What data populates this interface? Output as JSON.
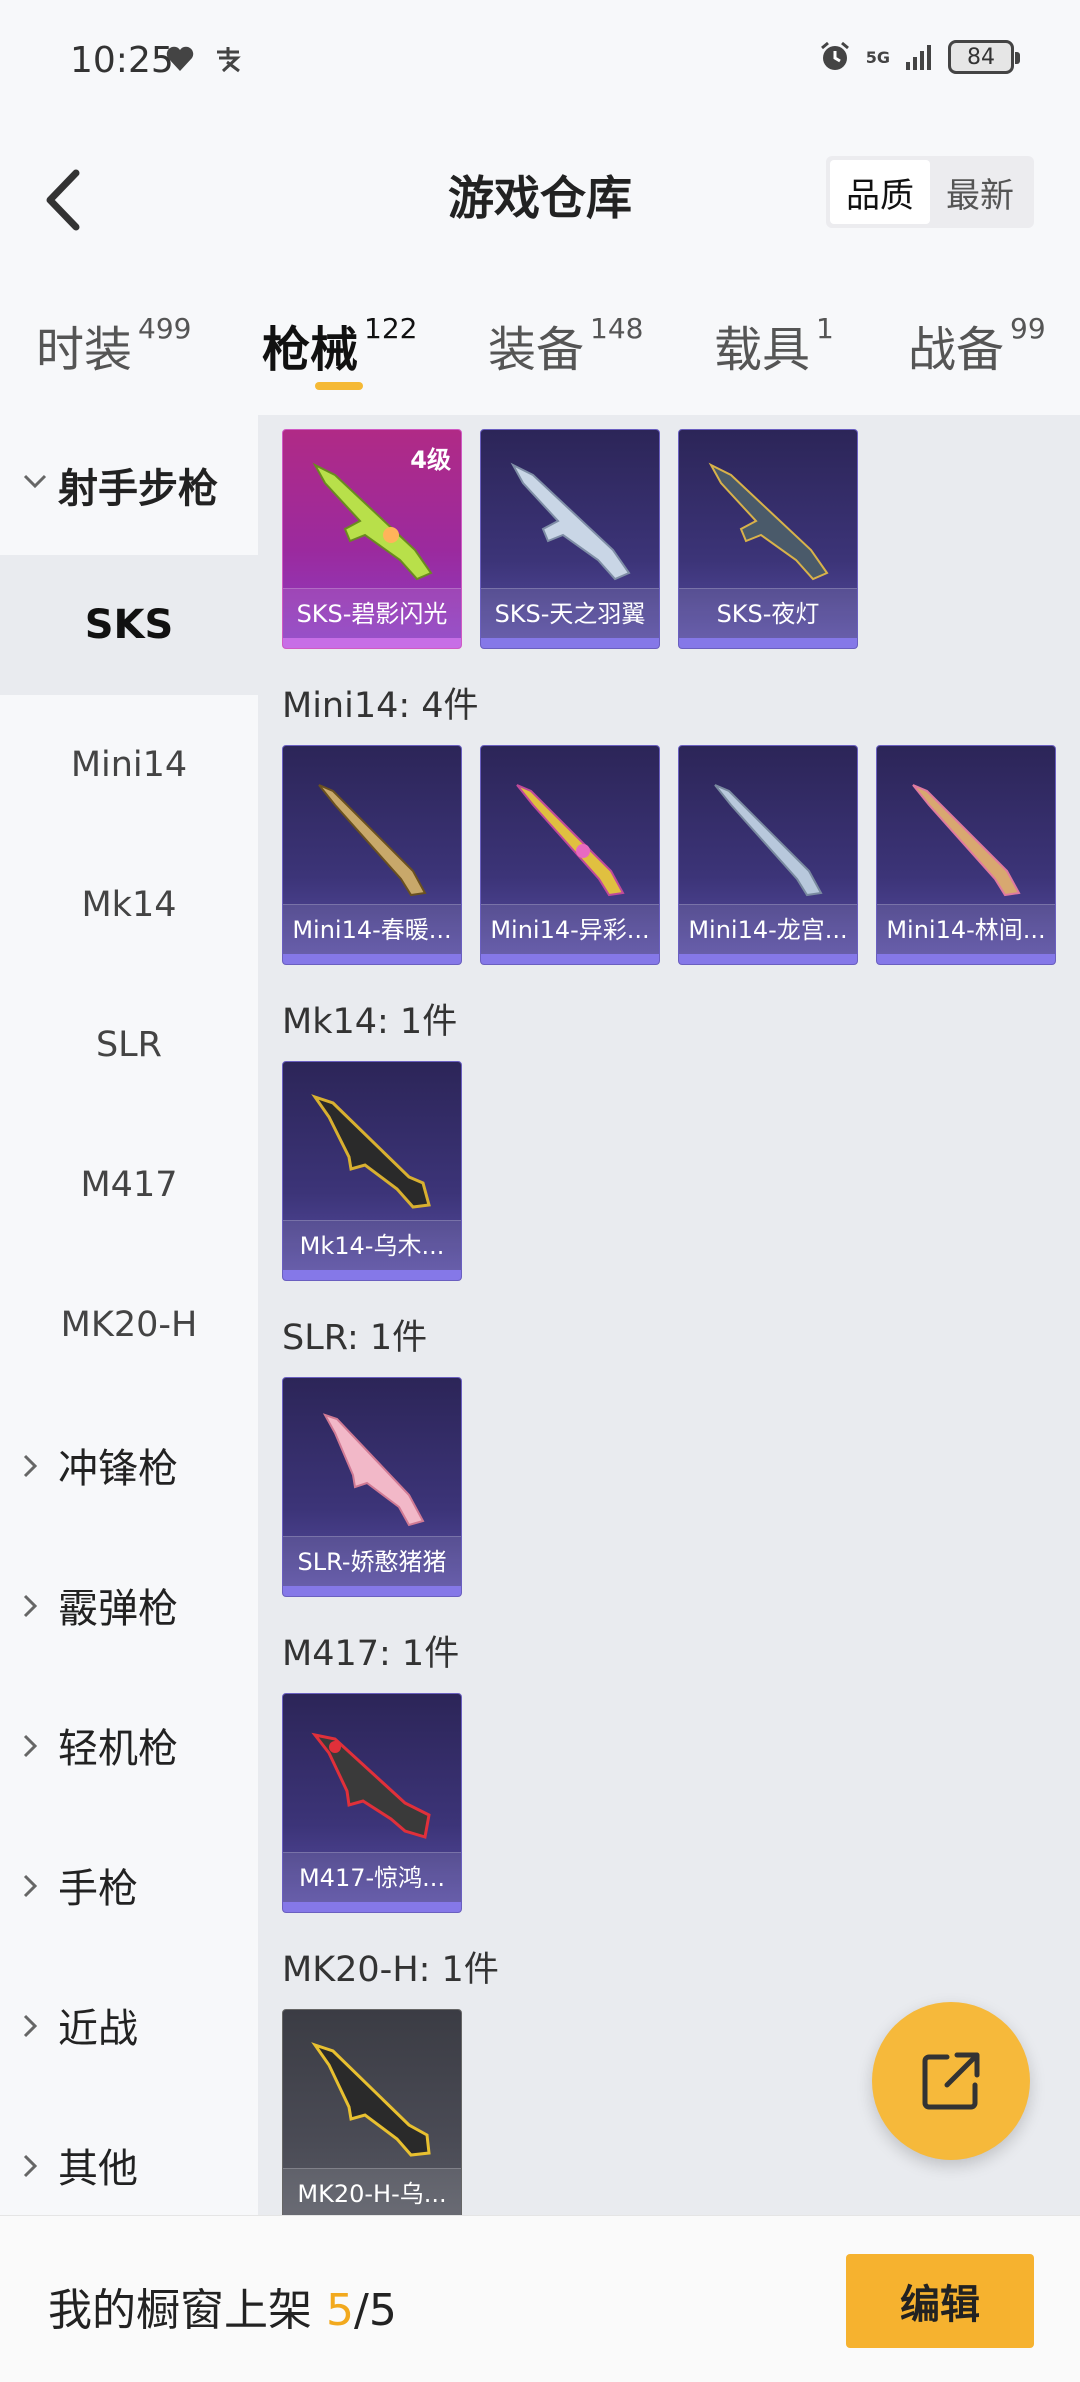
{
  "status": {
    "time": "10:25",
    "network": "5G",
    "battery": "84"
  },
  "header": {
    "title": "游戏仓库",
    "sort_quality": "品质",
    "sort_latest": "最新"
  },
  "tabs": [
    {
      "label": "时装",
      "count": "499"
    },
    {
      "label": "枪械",
      "count": "122"
    },
    {
      "label": "装备",
      "count": "148"
    },
    {
      "label": "载具",
      "count": "1"
    },
    {
      "label": "战备",
      "count": "99"
    }
  ],
  "sidebar": {
    "group_open": "射手步枪",
    "subs": [
      "SKS",
      "Mini14",
      "Mk14",
      "SLR",
      "M417",
      "MK20-H"
    ],
    "groups": [
      "冲锋枪",
      "霰弹枪",
      "轻机枪",
      "手枪",
      "近战",
      "其他"
    ]
  },
  "sections": [
    {
      "title": "",
      "items": [
        {
          "name": "SKS-碧影闪光",
          "level": "4级",
          "rarity": "pink"
        },
        {
          "name": "SKS-天之羽翼",
          "rarity": "purple"
        },
        {
          "name": "SKS-夜灯",
          "rarity": "purple"
        }
      ]
    },
    {
      "title": "Mini14: 4件",
      "items": [
        {
          "name": "Mini14-春暖...",
          "rarity": "purple"
        },
        {
          "name": "Mini14-异彩...",
          "rarity": "purple"
        },
        {
          "name": "Mini14-龙宫...",
          "rarity": "purple"
        },
        {
          "name": "Mini14-林间...",
          "rarity": "purple"
        }
      ]
    },
    {
      "title": "Mk14: 1件",
      "items": [
        {
          "name": "Mk14-乌木...",
          "rarity": "purple"
        }
      ]
    },
    {
      "title": "SLR: 1件",
      "items": [
        {
          "name": "SLR-娇憨猪猪",
          "rarity": "purple"
        }
      ]
    },
    {
      "title": "M417: 1件",
      "items": [
        {
          "name": "M417-惊鸿...",
          "rarity": "purple"
        }
      ]
    },
    {
      "title": "MK20-H: 1件",
      "items": [
        {
          "name": "MK20-H-乌...",
          "rarity": "gray"
        }
      ]
    }
  ],
  "bottom": {
    "showcase_label": "我的橱窗上架",
    "showcase_used": "5",
    "showcase_sep": "/",
    "showcase_total": "5",
    "edit_label": "编辑"
  },
  "colors": {
    "accent": "#f6b22f",
    "highlight": "#f2a91e"
  }
}
